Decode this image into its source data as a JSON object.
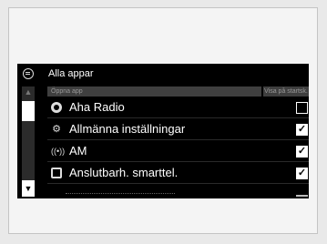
{
  "screen": {
    "title": "Alla appar",
    "columns": {
      "app": "Öppna app",
      "show": "Visa på startsk."
    },
    "rows": [
      {
        "icon": "aha-radio-icon",
        "label": "Aha Radio",
        "checked": false
      },
      {
        "icon": "gear-icon",
        "label": "Allmänna inställningar",
        "checked": true
      },
      {
        "icon": "radio-antenna-icon",
        "label": "AM",
        "checked": true
      },
      {
        "icon": "smartphone-icon",
        "label": "Anslutbarh. smarttel.",
        "checked": true
      }
    ]
  }
}
